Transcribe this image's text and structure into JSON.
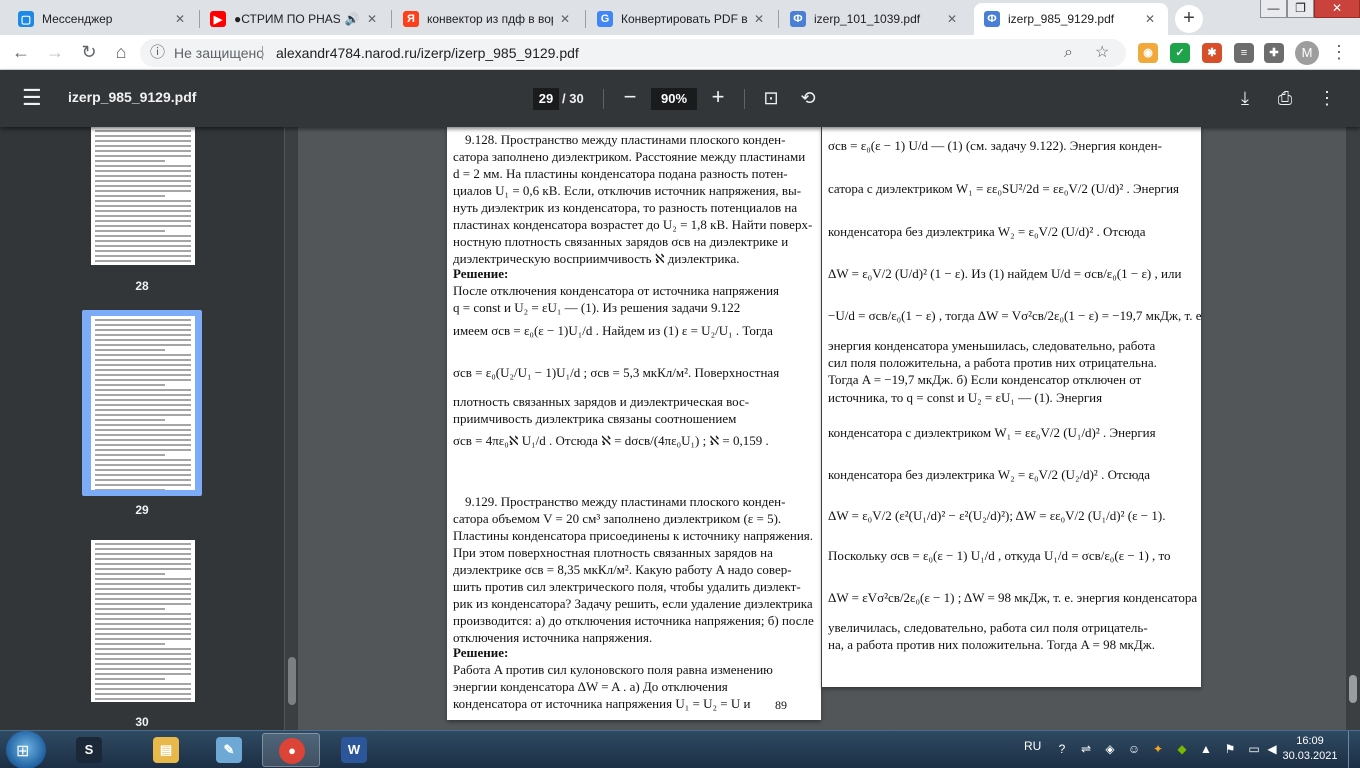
{
  "tabs": [
    {
      "title": "Мессенджер",
      "icon": "messenger-icon",
      "color": "#1e88e5",
      "glyph": "▢"
    },
    {
      "title": "●СТРИМ ПО PHASMOPHOBIA",
      "icon": "youtube-icon",
      "color": "#ff0000",
      "glyph": "▶",
      "audio": "🔊"
    },
    {
      "title": "конвектор из пдф в ворд",
      "icon": "yandex-icon",
      "color": "#fc3f1d",
      "glyph": "Я"
    },
    {
      "title": "Конвертировать PDF в Word",
      "icon": "google-icon",
      "color": "#4285f4",
      "glyph": "G"
    },
    {
      "title": "izerp_101_1039.pdf",
      "icon": "pdf-icon",
      "color": "#4a7fd6",
      "glyph": "Ф"
    },
    {
      "title": "izerp_985_9129.pdf",
      "icon": "pdf-icon",
      "color": "#4a7fd6",
      "glyph": "Ф",
      "active": true
    }
  ],
  "window": {
    "minimize": "—",
    "maximize": "❐",
    "close": "✕"
  },
  "toolbar": {
    "not_secure": "Не защищено",
    "url": "alexandr4784.narod.ru/izerp/izerp_985_9129.pdf",
    "back": "←",
    "forward": "→",
    "reload": "↻",
    "home": "⌂",
    "zoom_icon": "⌕",
    "star": "☆",
    "avatar": "M",
    "menu": "⋮"
  },
  "pdf": {
    "filename": "izerp_985_9129.pdf",
    "page": "29",
    "total": "/ 30",
    "zoom": "90%",
    "menu": "☰",
    "minus": "−",
    "plus": "+",
    "fit": "⊡",
    "rotate": "⟲",
    "download": "⤓",
    "print": "⎙",
    "more": "⋮"
  },
  "thumbnails": [
    {
      "label": "28"
    },
    {
      "label": "29",
      "selected": true
    },
    {
      "label": "30"
    }
  ],
  "left_page": {
    "lines": [
      "9.128. Пространство между пластинами плоского конден-",
      "сатора заполнено диэлектриком. Расстояние между пластинами",
      "d = 2 мм. На пластины конденсатора подана разность потен-",
      "циалов U₁ = 0,6 кВ. Если, отключив источник напряжения, вы-",
      "нуть диэлектрик из конденсатора, то разность потенциалов на",
      "пластинах конденсатора возрастет до U₂ = 1,8 кВ. Найти поверх-",
      "ностную плотность связанных зарядов σсв на диэлектрике и",
      "диэлектрическую восприимчивость ℵ диэлектрика.",
      "Решение:",
      "После отключения конденсатора от источника напряжения",
      "q = const  и  U₂ = εU₁  — (1). Из решения задачи 9.122",
      "имеем  σсв = ε₀(ε − 1)U₁/d .  Найдем из (1)  ε = U₂/U₁ .  Тогда",
      "σсв = ε₀(U₂/U₁ − 1)U₁/d ;     σсв = 5,3 мкКл/м².      Поверхностная",
      "плотность связанных зарядов и диэлектрическая вос-",
      "приимчивость      диэлектрика    связаны    соотношением",
      "σсв = 4πε₀ℵ U₁/d . Отсюда ℵ = dσсв/(4πε₀U₁) ;  ℵ = 0,159 .",
      "9.129. Пространство между пластинами плоского конден-",
      "сатора объемом  V = 20 см³  заполнено диэлектриком  (ε = 5).",
      "Пластины конденсатора присоединены к источнику напряжения.",
      "При этом поверхностная плотность связанных зарядов на",
      "диэлектрике  σсв = 8,35 мкКл/м². Какую работу A надо совер-",
      "шить против сил электрического поля, чтобы удалить диэлект-",
      "рик из конденсатора? Задачу решить, если удаление диэлектрика",
      "производится: а) до отключения источника напряжения; б) после",
      "отключения источника напряжения.",
      "Решение:",
      "Работа  A  против сил кулоновского поля равна изменению",
      "энергии    конденсатора    ΔW = A .  а)   До   отключения",
      "конденсатора   от   источника   напряжения   U₁ = U₂ = U   и"
    ],
    "page_number": "89"
  },
  "right_page": {
    "lines": [
      "σсв = ε₀(ε − 1) U/d — (1) (см. задачу 9.122). Энергия конден-",
      "сатора с диэлектриком  W₁ = εε₀SU²/2d = εε₀V/2 (U/d)² . Энергия",
      "конденсатора  без  диэлектрика  W₂ = ε₀V/2 (U/d)² .  Отсюда",
      "ΔW = ε₀V/2 (U/d)² (1 − ε).  Из  (1)  найдем   U/d = σсв/ε₀(1 − ε) ,  или",
      "−U/d = σсв/ε₀(1 − ε) ,   тогда   ΔW = Vσ²св/2ε₀(1 − ε) = −19,7 мкДж,  т. е.",
      "энергия конденсатора уменьшилась, следовательно, работа",
      "сил поля положительна, а работа против них отрицательна.",
      "Тогда   A = −19,7 мкДж.  б)  Если  конденсатор  отключен  от",
      "источника,   то   q = const   и   U₂ = εU₁   —  (1).  Энергия",
      "конденсатора  с  диэлектриком  W₁ = εε₀V/2 (U₁/d)² .  Энергия",
      "конденсатора  без  диэлектрика  W₂ = ε₀V/2 (U₂/d)² .  Отсюда",
      "ΔW = ε₀V/2 (ε²(U₁/d)² − ε²(U₂/d)²);    ΔW = εε₀V/2 (U₁/d)² (ε − 1).",
      "Поскольку    σсв = ε₀(ε − 1) U₁/d ,    откуда    U₁/d = σсв/ε₀(ε − 1) ,   то",
      "ΔW = εVσ²св/2ε₀(ε − 1) ;  ΔW = 98 мкДж, т. е. энергия конденсатора",
      "увеличилась, следовательно, работа сил поля отрицатель-",
      "на, а работа против них положительна. Тогда  A = 98 мкДж."
    ]
  },
  "taskbar": {
    "apps": [
      {
        "name": "steam",
        "glyph": "S",
        "color": "#1b2838"
      },
      {
        "name": "explorer",
        "glyph": "▤",
        "color": "#e8b84a"
      },
      {
        "name": "paint",
        "glyph": "✎",
        "color": "#6ea9d6"
      },
      {
        "name": "chrome",
        "glyph": "●",
        "color": "#db4437",
        "active": true
      },
      {
        "name": "word",
        "glyph": "W",
        "color": "#2b579a"
      }
    ],
    "lang": "RU",
    "time": "16:09",
    "date": "30.03.2021"
  }
}
